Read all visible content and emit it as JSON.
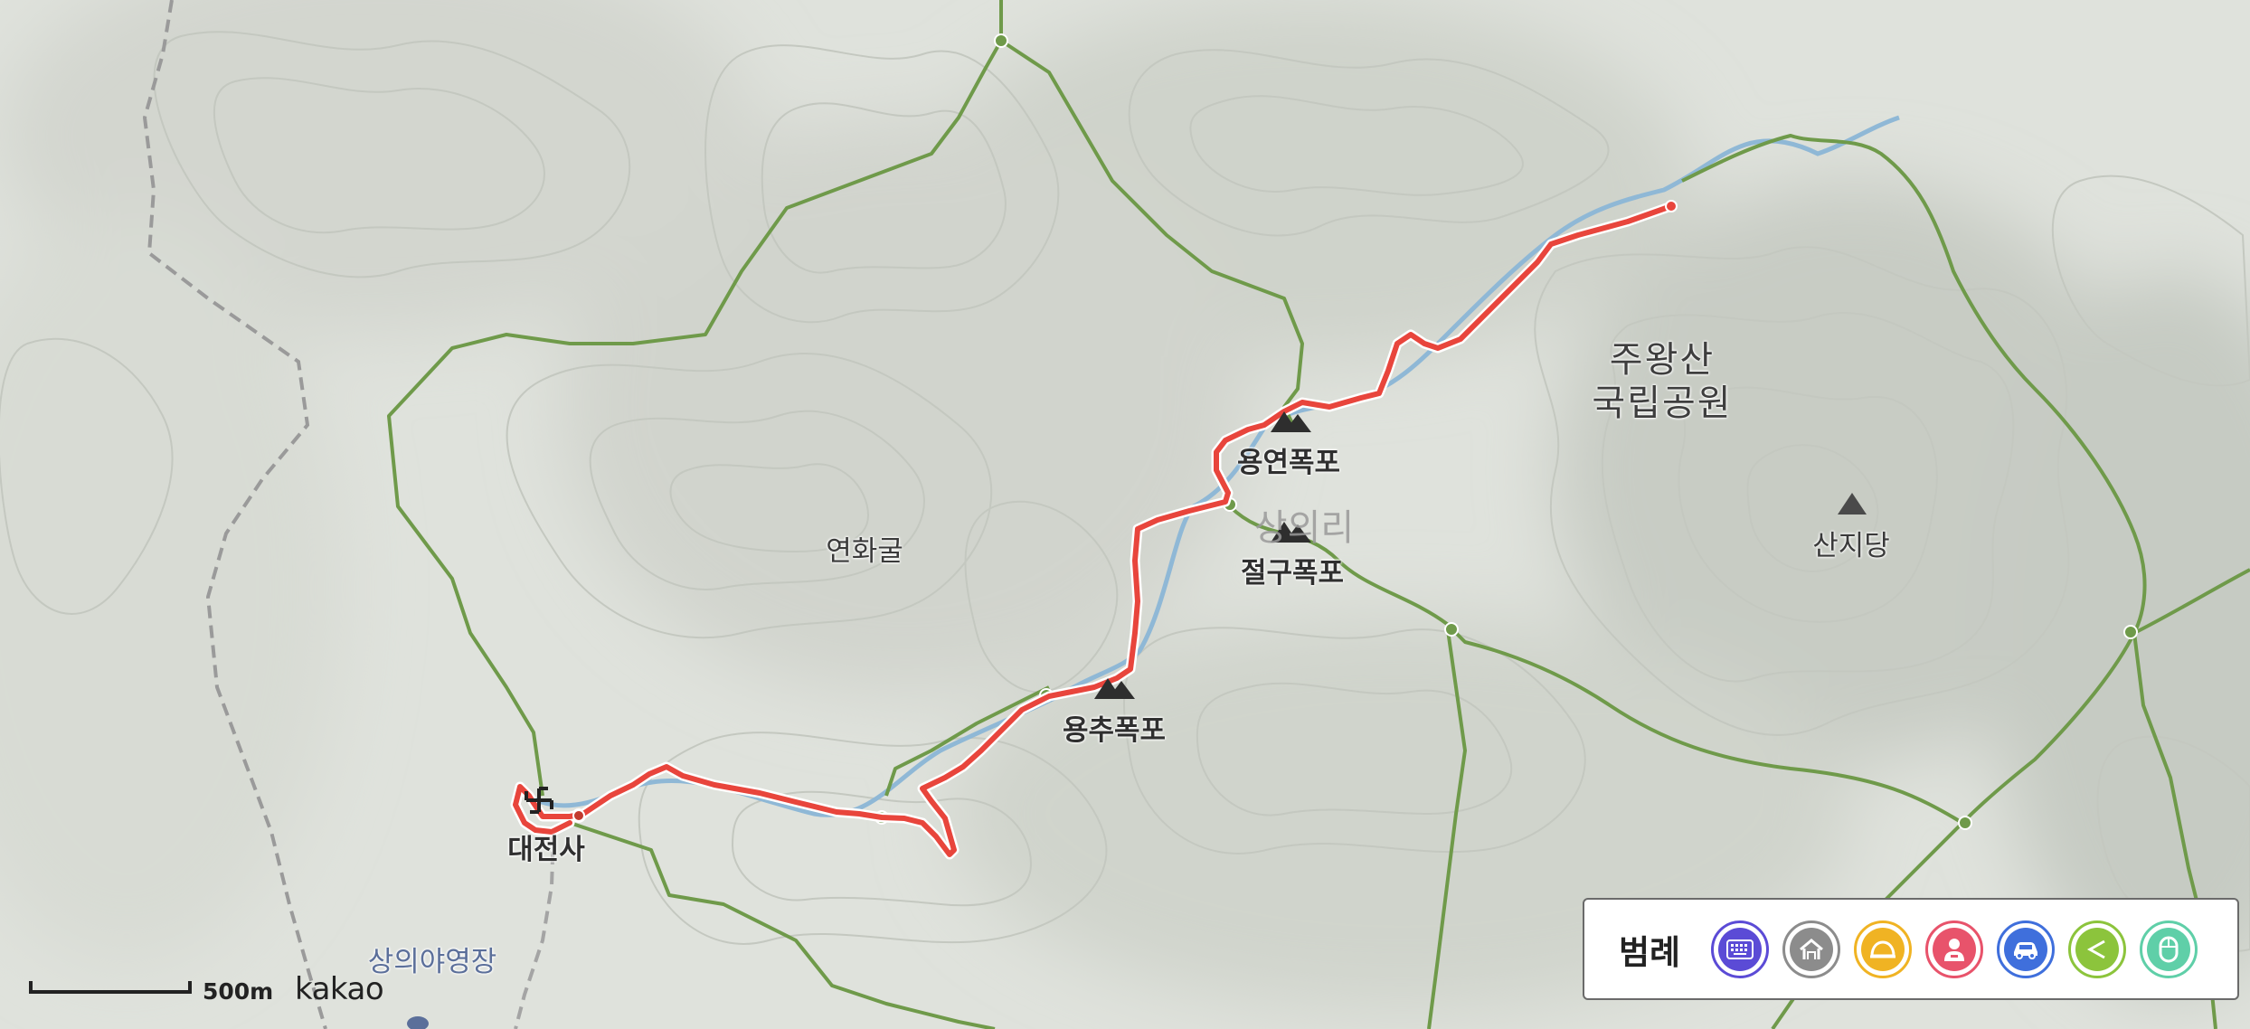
{
  "map": {
    "places": {
      "park": [
        "주왕산",
        "국립공원"
      ],
      "yeonhwagul": "연화굴",
      "yongyeon": "용연폭포",
      "jeolgu": "절구폭포",
      "yongchu": "용추폭포",
      "daejeonsa": "대전사",
      "sanjidang": "산지당",
      "sangui_village": "상의리",
      "campsite": "상의야영장"
    },
    "scale_label": "500m",
    "brand": "kakao",
    "route_color": "#e8453c",
    "trail_color": "#6f9a4a",
    "stream_color": "#8fb8d6"
  },
  "legend": {
    "title": "범례",
    "items": [
      {
        "icon": "keyboard-icon",
        "color": "#5b4bd6"
      },
      {
        "icon": "shelter-icon",
        "color": "#8c8c8c"
      },
      {
        "icon": "helipad-icon",
        "color": "#f0b323"
      },
      {
        "icon": "person-icon",
        "color": "#e8536b"
      },
      {
        "icon": "car-icon",
        "color": "#3f6fdc"
      },
      {
        "icon": "share-icon",
        "color": "#8cc43c"
      },
      {
        "icon": "mouse-icon",
        "color": "#5fcfa8"
      }
    ]
  }
}
